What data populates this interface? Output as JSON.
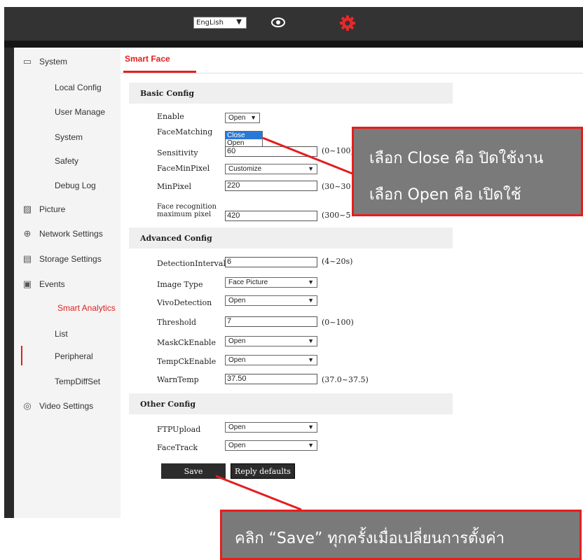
{
  "header": {
    "language": "EngLish",
    "view_icon": "eye-icon",
    "settings_icon": "gear-icon"
  },
  "sidebar": {
    "items": [
      {
        "label": "System",
        "icon": "monitor-icon"
      },
      {
        "label": "Local Config"
      },
      {
        "label": "User Manage"
      },
      {
        "label": "System"
      },
      {
        "label": "Safety"
      },
      {
        "label": "Debug Log"
      },
      {
        "label": "Picture",
        "icon": "picture-icon"
      },
      {
        "label": "Network Settings",
        "icon": "globe-icon"
      },
      {
        "label": "Storage Settings",
        "icon": "disk-icon"
      },
      {
        "label": "Events",
        "icon": "events-icon"
      },
      {
        "label": "Smart Analytics"
      },
      {
        "label": "List"
      },
      {
        "label": "Peripheral"
      },
      {
        "label": "TempDiffSet"
      },
      {
        "label": "Video Settings",
        "icon": "camera-icon"
      }
    ]
  },
  "main": {
    "tab": "Smart Face",
    "basic": {
      "title": "Basic Config",
      "enable_label": "Enable",
      "enable_value": "Open",
      "facematching_label": "FaceMatching",
      "facematching_options": [
        "Close",
        "Open"
      ],
      "sensitivity_label": "Sensitivity",
      "sensitivity_value": "60",
      "sensitivity_range": "(0~100)",
      "faceminpixel_label": "FaceMinPixel",
      "faceminpixel_value": "Customize",
      "minpixel_label": "MinPixel",
      "minpixel_value": "220",
      "minpixel_range": "(30~30",
      "facerec_label_1": "Face recognition",
      "facerec_label_2": "maximum pixel",
      "facerec_value": "420",
      "facerec_range": "(300~5"
    },
    "advanced": {
      "title": "Advanced Config",
      "detection_label": "DetectionInterval",
      "detection_value": "6",
      "detection_range": "(4~20s)",
      "imagetype_label": "Image Type",
      "imagetype_value": "Face Picture",
      "vivo_label": "VivoDetection",
      "vivo_value": "Open",
      "threshold_label": "Threshold",
      "threshold_value": "7",
      "threshold_range": "(0~100)",
      "mask_label": "MaskCkEnable",
      "mask_value": "Open",
      "temp_label": "TempCkEnable",
      "temp_value": "Open",
      "warn_label": "WarnTemp",
      "warn_value": "37.50",
      "warn_range": "(37.0~37.5)"
    },
    "other": {
      "title": "Other Config",
      "ftp_label": "FTPUpload",
      "ftp_value": "Open",
      "facetrack_label": "FaceTrack",
      "facetrack_value": "Open"
    },
    "buttons": {
      "save": "Save",
      "reply": "Reply defaults"
    }
  },
  "callouts": {
    "select_line1": "เลือก Close คือ ปิดใช้งาน",
    "select_line2": "เลือก Open คือ เปิดใช้",
    "save_note": "คลิก “Save” ทุกครั้งเมื่อเปลี่ยนการตั้งค่า"
  },
  "colors": {
    "accent": "#e02020",
    "topbar": "#333333",
    "callout_bg": "#7a7a7a",
    "callout_border": "#e41e1e"
  }
}
